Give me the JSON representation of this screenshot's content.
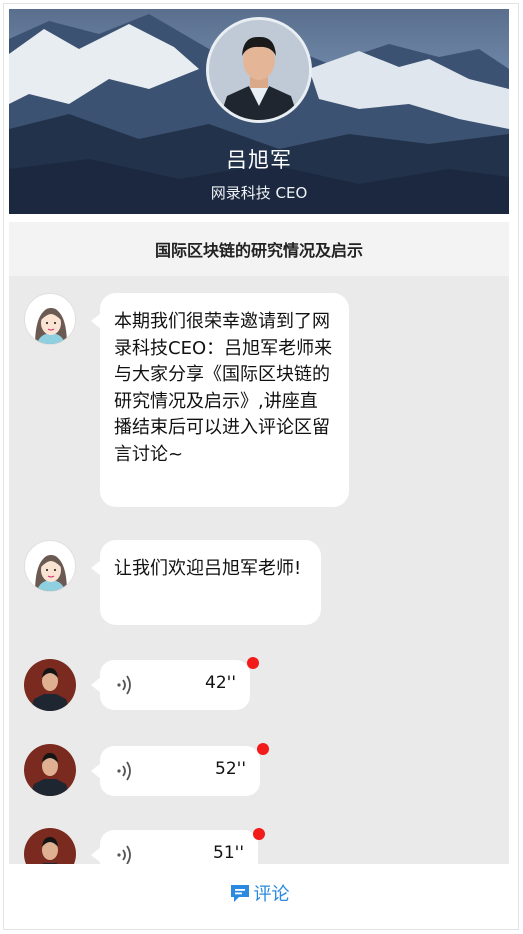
{
  "header": {
    "name": "吕旭军",
    "subtitle": "网录科技 CEO"
  },
  "title": "国际区块链的研究情况及启示",
  "messages": [
    {
      "text": "本期我们很荣幸邀请到了网录科技CEO：吕旭军老师来与大家分享《国际区块链的研究情况及启示》,讲座直播结束后可以进入评论区留言讨论~"
    },
    {
      "text": "让我们欢迎吕旭军老师!"
    }
  ],
  "voice_messages": [
    {
      "duration": "42''"
    },
    {
      "duration": "52''"
    },
    {
      "duration": "51''"
    }
  ],
  "footer": {
    "comment_label": "评论"
  },
  "colors": {
    "accent": "#2b8ae0",
    "unread_dot": "#f31a1a",
    "chat_bg": "#eaeaea"
  }
}
